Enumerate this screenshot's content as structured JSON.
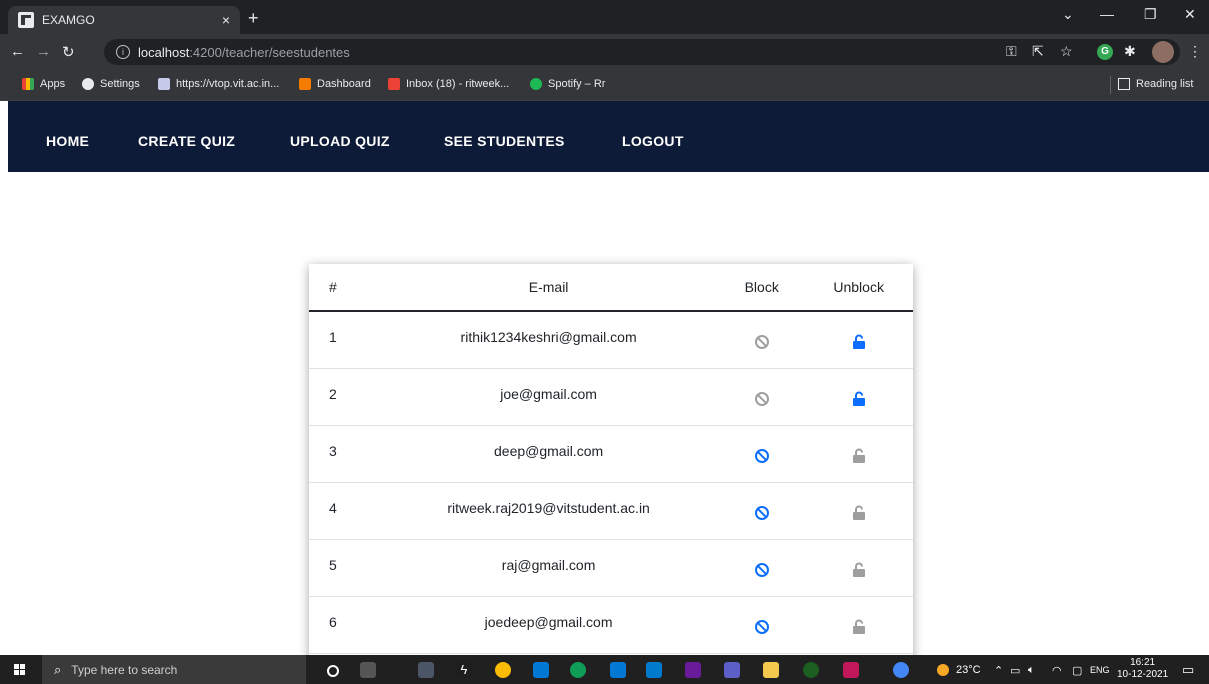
{
  "browser": {
    "tab_title": "EXAMGO",
    "tab_close": "×",
    "new_tab": "+",
    "url_host": "localhost",
    "url_path": ":4200/teacher/seestudentes",
    "bookmarks": [
      {
        "label": "Apps"
      },
      {
        "label": "Settings"
      },
      {
        "label": "https://vtop.vit.ac.in..."
      },
      {
        "label": "Dashboard"
      },
      {
        "label": "Inbox (18) - ritweek..."
      },
      {
        "label": "Spotify – Rr"
      }
    ],
    "reading_list": "Reading list"
  },
  "nav": {
    "items": [
      "HOME",
      "CREATE QUIZ",
      "UPLOAD QUIZ",
      "SEE STUDENTES",
      "LOGOUT"
    ]
  },
  "table": {
    "headers": {
      "num": "#",
      "email": "E-mail",
      "block": "Block",
      "unblock": "Unblock"
    },
    "rows": [
      {
        "num": "1",
        "email": "rithik1234keshri@gmail.com",
        "blocked": true
      },
      {
        "num": "2",
        "email": "joe@gmail.com",
        "blocked": true
      },
      {
        "num": "3",
        "email": "deep@gmail.com",
        "blocked": false
      },
      {
        "num": "4",
        "email": "ritweek.raj2019@vitstudent.ac.in",
        "blocked": false
      },
      {
        "num": "5",
        "email": "raj@gmail.com",
        "blocked": false
      },
      {
        "num": "6",
        "email": "joedeep@gmail.com",
        "blocked": false
      }
    ]
  },
  "colors": {
    "nav_bg": "#0d1b38",
    "active_icon": "#0d6efd",
    "disabled_icon": "#9e9e9e"
  },
  "taskbar": {
    "search_placeholder": "Type here to search",
    "weather": "23°C",
    "lang": "ENG",
    "time": "16:21",
    "date": "10-12-2021"
  }
}
